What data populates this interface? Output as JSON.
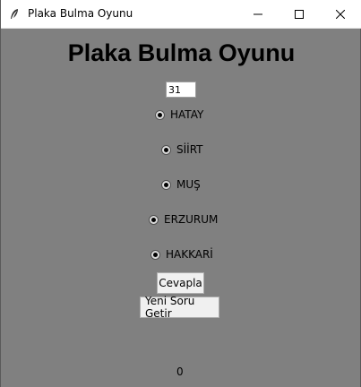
{
  "window": {
    "title": "Plaka Bulma Oyunu"
  },
  "heading": "Plaka Bulma Oyunu",
  "input": {
    "value": "31"
  },
  "options": [
    {
      "label": "HATAY"
    },
    {
      "label": "SİİRT"
    },
    {
      "label": "MUŞ"
    },
    {
      "label": "ERZURUM"
    },
    {
      "label": "HAKKARİ"
    }
  ],
  "buttons": {
    "answer": "Cevapla",
    "new_question": "Yeni Soru Getir"
  },
  "score": "0",
  "icons": {
    "app": "feather-icon",
    "minimize": "minimize-icon",
    "maximize": "maximize-icon",
    "close": "close-icon"
  }
}
